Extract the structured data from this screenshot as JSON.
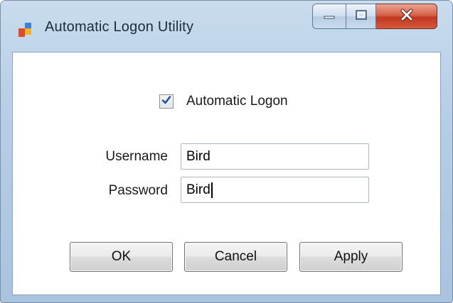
{
  "window": {
    "title": "Automatic Logon Utility",
    "icon": "app-window-icon"
  },
  "title_controls": {
    "minimize_icon": "minimize-icon",
    "maximize_icon": "maximize-icon",
    "close_icon": "close-icon"
  },
  "form": {
    "auto_logon": {
      "label": "Automatic Logon",
      "checked": true
    },
    "username": {
      "label": "Username",
      "value": "Bird"
    },
    "password": {
      "label": "Password",
      "value": "Bird"
    }
  },
  "buttons": {
    "ok": "OK",
    "cancel": "Cancel",
    "apply": "Apply"
  },
  "colors": {
    "title_bar": "#b7cee6",
    "close_button": "#c9452a",
    "check_mark": "#2a4f9e"
  }
}
